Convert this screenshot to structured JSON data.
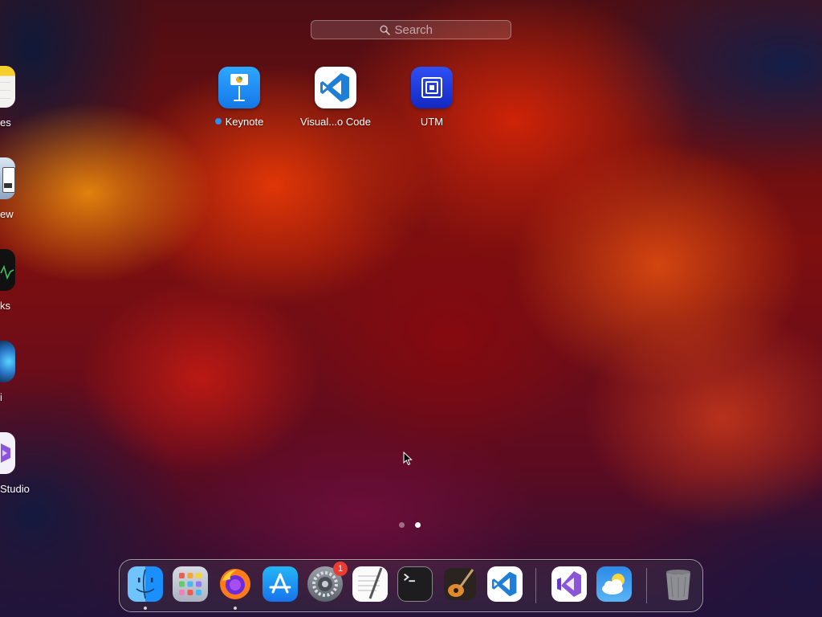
{
  "search": {
    "placeholder": "Search"
  },
  "apps": [
    {
      "label": "Keynote",
      "icon": "keynote-icon",
      "new": true
    },
    {
      "label": "Visual...o Code",
      "icon": "vscode-icon"
    },
    {
      "label": "UTM",
      "icon": "utm-icon"
    }
  ],
  "side_apps": [
    {
      "label": "es",
      "icon": "notes-icon"
    },
    {
      "label": "ew",
      "icon": "preview-icon"
    },
    {
      "label": "ks",
      "icon": "stocks-icon"
    },
    {
      "label": "i",
      "icon": "siri-icon"
    },
    {
      "label": "Studio",
      "icon": "visual-studio-icon"
    }
  ],
  "page_indicator": {
    "total": 2,
    "current": 2
  },
  "dock": {
    "items": [
      {
        "name": "finder",
        "icon": "finder-icon",
        "running": true
      },
      {
        "name": "launchpad",
        "icon": "launchpad-icon"
      },
      {
        "name": "firefox",
        "icon": "firefox-icon",
        "running": true
      },
      {
        "name": "app-store",
        "icon": "app-store-icon"
      },
      {
        "name": "system-settings",
        "icon": "settings-icon",
        "badge": "1"
      },
      {
        "name": "textedit",
        "icon": "textedit-icon"
      },
      {
        "name": "terminal",
        "icon": "terminal-icon"
      },
      {
        "name": "garageband",
        "icon": "garageband-icon"
      },
      {
        "name": "vscode",
        "icon": "vscode-icon"
      },
      {
        "name": "visual-studio",
        "icon": "visual-studio-icon"
      },
      {
        "name": "weather",
        "icon": "weather-icon"
      },
      {
        "name": "trash",
        "icon": "trash-icon"
      }
    ]
  },
  "colors": {
    "badge": "#ec3b30",
    "new_dot": "#2b8cf5",
    "keynote_blue": "#1f8ff0",
    "vscode_blue": "#1f7fd6",
    "utm_blue": "#1f3fe0"
  }
}
